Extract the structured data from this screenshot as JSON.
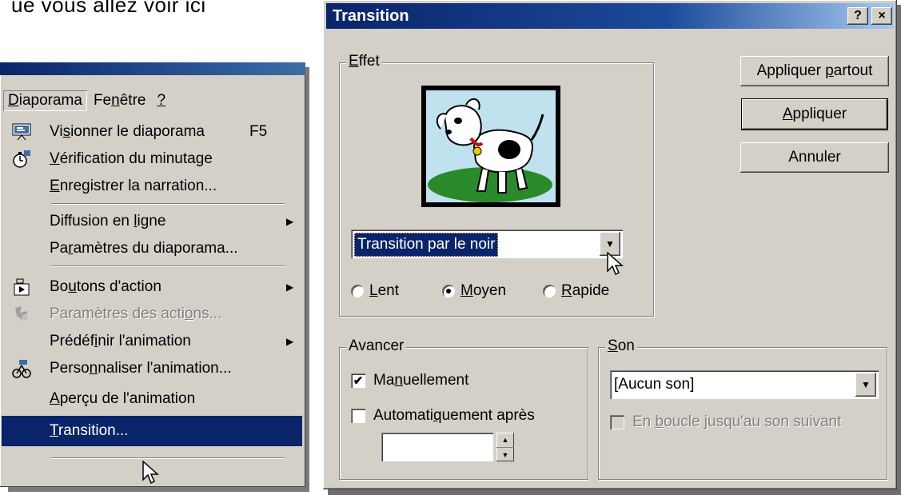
{
  "top_text": "ue vous allez voir ici ",
  "menu": {
    "menubar": [
      {
        "label": "Diaporama",
        "active": true
      },
      {
        "label": "Fenêtre",
        "active": false
      },
      {
        "label": "?",
        "active": false
      }
    ],
    "items": [
      {
        "label": "Visionner le diaporama",
        "shortcut": "F5",
        "icon": "slideshow-icon",
        "submenu": false,
        "disabled": false,
        "selected": false
      },
      {
        "label": "Vérification du minutage",
        "icon": "stopwatch-icon",
        "submenu": false,
        "disabled": false,
        "selected": false
      },
      {
        "label": "Enregistrer la narration...",
        "icon": "",
        "submenu": false,
        "disabled": false,
        "selected": false
      },
      {
        "label": "Diffusion en ligne",
        "icon": "",
        "submenu": true,
        "disabled": false,
        "selected": false
      },
      {
        "label": "Paramètres du diaporama...",
        "icon": "",
        "submenu": false,
        "disabled": false,
        "selected": false
      },
      {
        "label": "Boutons d'action",
        "icon": "action-buttons-icon",
        "submenu": true,
        "disabled": false,
        "selected": false
      },
      {
        "label": "Paramètres des actions...",
        "icon": "action-settings-icon",
        "submenu": false,
        "disabled": true,
        "selected": false
      },
      {
        "label": "Prédéfinir l'animation",
        "icon": "",
        "submenu": true,
        "disabled": false,
        "selected": false
      },
      {
        "label": "Personnaliser l'animation...",
        "icon": "custom-animation-icon",
        "submenu": false,
        "disabled": false,
        "selected": false
      },
      {
        "label": "Aperçu de l'animation",
        "icon": "",
        "submenu": false,
        "disabled": false,
        "selected": false
      },
      {
        "label": "Transition...",
        "icon": "",
        "submenu": false,
        "disabled": false,
        "selected": true
      }
    ]
  },
  "dialog": {
    "title": "Transition",
    "help_button": "?",
    "close_button": "×",
    "effet": {
      "legend": "Effet",
      "effect_value": "Transition par le noir",
      "speeds": [
        {
          "label": "Lent",
          "checked": false
        },
        {
          "label": "Moyen",
          "checked": true
        },
        {
          "label": "Rapide",
          "checked": false
        }
      ]
    },
    "buttons": {
      "apply_all": "Appliquer partout",
      "apply": "Appliquer",
      "cancel": "Annuler"
    },
    "avancer": {
      "legend": "Avancer",
      "manual_label": "Manuellement",
      "manual_checked": true,
      "auto_label": "Automatiquement après",
      "auto_checked": false,
      "auto_value": ""
    },
    "son": {
      "legend": "Son",
      "sound_value": "[Aucun son]",
      "loop_label": "En boucle jusqu'au son suivant",
      "loop_checked": false,
      "loop_disabled": true
    }
  }
}
